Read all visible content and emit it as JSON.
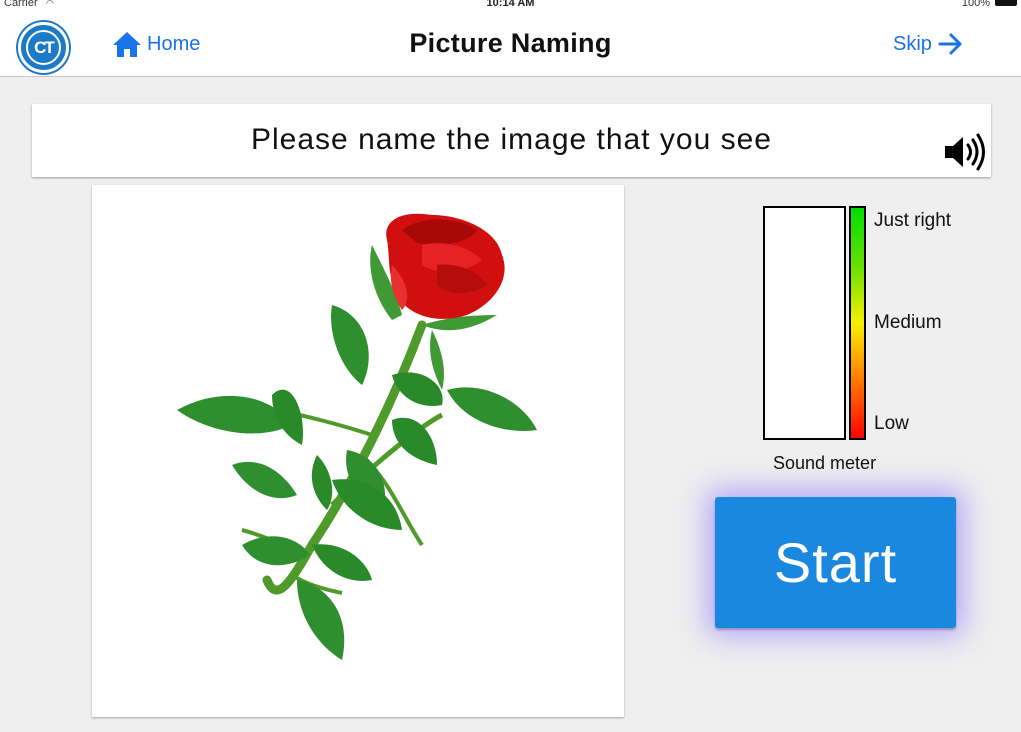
{
  "status_bar": {
    "carrier": "Carrier",
    "time": "10:14 AM",
    "battery": "100%"
  },
  "nav": {
    "logo_text": "CT",
    "home_label": "Home",
    "title": "Picture Naming",
    "skip_label": "Skip"
  },
  "prompt": {
    "text": "Please name the image that you see",
    "audio_icon": "speaker-icon"
  },
  "image": {
    "subject": "rose-illustration"
  },
  "sound_meter": {
    "level": 0,
    "labels": {
      "high": "Just right",
      "mid": "Medium",
      "low": "Low"
    },
    "caption": "Sound meter"
  },
  "start_button": {
    "label": "Start"
  },
  "colors": {
    "accent": "#1a73e8",
    "start_button": "#1b88e0",
    "logo": "#1c7ac9",
    "rose_red": "#d10f0f",
    "leaf_green": "#2f8f2f"
  }
}
